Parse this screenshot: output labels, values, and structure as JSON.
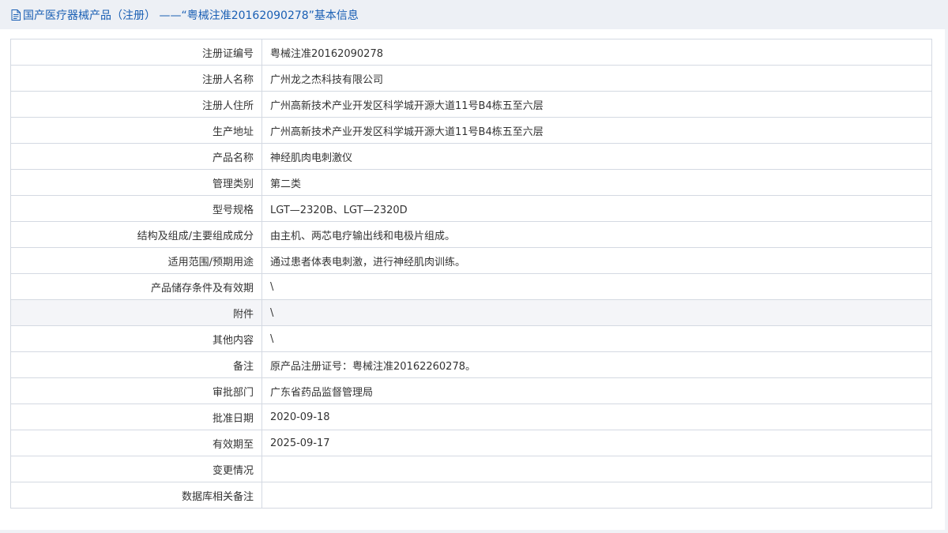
{
  "header": {
    "icon": "document-icon",
    "title": "国产医疗器械产品（注册） ——“粤械注准20162090278”基本信息",
    "color": "#1a5fb4"
  },
  "table": {
    "rows": [
      {
        "label": "注册证编号",
        "value": "粤械注准20162090278"
      },
      {
        "label": "注册人名称",
        "value": "广州龙之杰科技有限公司"
      },
      {
        "label": "注册人住所",
        "value": "广州高新技术产业开发区科学城开源大道11号B4栋五至六层"
      },
      {
        "label": "生产地址",
        "value": "广州高新技术产业开发区科学城开源大道11号B4栋五至六层"
      },
      {
        "label": "产品名称",
        "value": "神经肌肉电刺激仪"
      },
      {
        "label": "管理类别",
        "value": "第二类"
      },
      {
        "label": "型号规格",
        "value": "LGT—2320B、LGT—2320D"
      },
      {
        "label": "结构及组成/主要组成成分",
        "value": "由主机、两芯电疗输出线和电极片组成。"
      },
      {
        "label": "适用范围/预期用途",
        "value": "通过患者体表电刺激，进行神经肌肉训练。"
      },
      {
        "label": "产品储存条件及有效期",
        "value": "\\"
      },
      {
        "label": "附件",
        "value": "\\"
      },
      {
        "label": "其他内容",
        "value": "\\"
      },
      {
        "label": "备注",
        "value": "原产品注册证号：粤械注准20162260278。"
      },
      {
        "label": "审批部门",
        "value": "广东省药品监督管理局"
      },
      {
        "label": "批准日期",
        "value": "2020-09-18"
      },
      {
        "label": "有效期至",
        "value": "2025-09-17"
      },
      {
        "label": "变更情况",
        "value": ""
      },
      {
        "label": "数据库相关备注",
        "value": ""
      }
    ]
  }
}
